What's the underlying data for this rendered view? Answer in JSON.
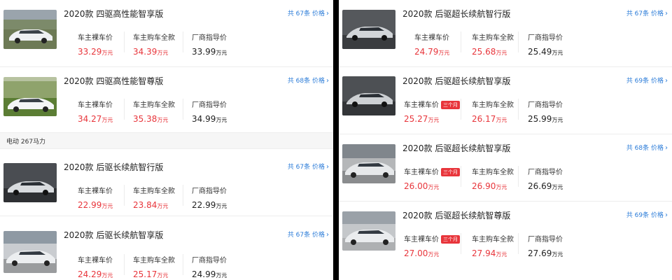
{
  "left": {
    "cards": [
      {
        "title": "2020款 四驱高性能智享版",
        "count": "共 67条 价格",
        "p1_label": "车主裸车价",
        "p1_value": "33.29",
        "p1_unit": "万元",
        "p2_label": "车主购车全款",
        "p2_value": "34.39",
        "p2_unit": "万元",
        "p3_label": "厂商指导价",
        "p3_value": "33.99",
        "p3_unit": "万元"
      },
      {
        "title": "2020款 四驱高性能智尊版",
        "count": "共 68条 价格",
        "p1_label": "车主裸车价",
        "p1_value": "34.27",
        "p1_unit": "万元",
        "p2_label": "车主购车全款",
        "p2_value": "35.38",
        "p2_unit": "万元",
        "p3_label": "厂商指导价",
        "p3_value": "34.99",
        "p3_unit": "万元"
      },
      {
        "title": "2020款 后驱长续航智行版",
        "count": "共 67条 价格",
        "p1_label": "车主裸车价",
        "p1_value": "22.99",
        "p1_unit": "万元",
        "p2_label": "车主购车全款",
        "p2_value": "23.84",
        "p2_unit": "万元",
        "p3_label": "厂商指导价",
        "p3_value": "22.99",
        "p3_unit": "万元"
      },
      {
        "title": "2020款 后驱长续航智享版",
        "count": "共 67条 价格",
        "p1_label": "车主裸车价",
        "p1_value": "24.29",
        "p1_unit": "万元",
        "p2_label": "车主购车全款",
        "p2_value": "25.17",
        "p2_unit": "万元",
        "p3_label": "厂商指导价",
        "p3_value": "24.99",
        "p3_unit": "万元"
      }
    ],
    "section_label": "电动 267马力"
  },
  "right": {
    "cards": [
      {
        "title": "2020款 后驱超长续航智行版",
        "count": "共 67条 价格",
        "p1_label": "车主裸车价",
        "p1_value": "24.79",
        "p1_unit": "万元",
        "p2_label": "车主购车全款",
        "p2_value": "25.68",
        "p2_unit": "万元",
        "p3_label": "厂商指导价",
        "p3_value": "25.49",
        "p3_unit": "万元"
      },
      {
        "title": "2020款 后驱超长续航智享版",
        "count": "共 69条 价格",
        "tag": "三个月",
        "p1_label": "车主裸车价",
        "p1_value": "25.27",
        "p1_unit": "万元",
        "p2_label": "车主购车全款",
        "p2_value": "26.17",
        "p2_unit": "万元",
        "p3_label": "厂商指导价",
        "p3_value": "25.99",
        "p3_unit": "万元"
      },
      {
        "title": "2020款 后驱超长续航智享版",
        "count": "共 68条 价格",
        "tag": "三个月",
        "p1_label": "车主裸车价",
        "p1_value": "26.00",
        "p1_unit": "万元",
        "p2_label": "车主购车全款",
        "p2_value": "26.90",
        "p2_unit": "万元",
        "p3_label": "厂商指导价",
        "p3_value": "26.69",
        "p3_unit": "万元"
      },
      {
        "title": "2020款 后驱超长续航智尊版",
        "count": "共 69条 价格",
        "tag": "三个月",
        "p1_label": "车主裸车价",
        "p1_value": "27.00",
        "p1_unit": "万元",
        "p2_label": "车主购车全款",
        "p2_value": "27.94",
        "p2_unit": "万元",
        "p3_label": "厂商指导价",
        "p3_value": "27.69",
        "p3_unit": "万元"
      }
    ]
  },
  "icons": {
    "count_chevron": "chevron-right-icon"
  },
  "colors": {
    "price_red": "#e8353b",
    "link_blue": "#2a7bd8",
    "tag_red": "#e8353b"
  }
}
